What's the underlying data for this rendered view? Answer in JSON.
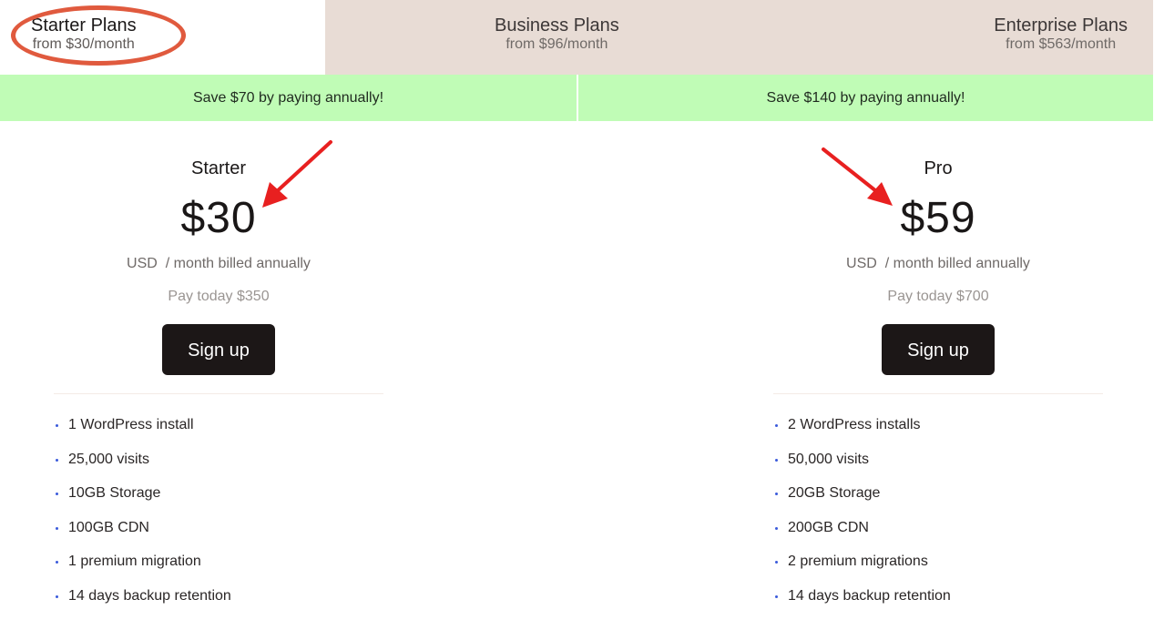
{
  "tabs": [
    {
      "title": "Starter Plans",
      "subtitle": "from $30/month",
      "active": true
    },
    {
      "title": "Business Plans",
      "subtitle": "from $96/month",
      "active": false
    },
    {
      "title": "Enterprise Plans",
      "subtitle": "from $563/month",
      "active": false
    }
  ],
  "savings": [
    "Save $70 by paying annually!",
    "Save $140 by paying annually!"
  ],
  "plans": [
    {
      "name": "Starter",
      "price": "$30",
      "period": "USD  / month billed annually",
      "pay_today": "Pay today $350",
      "cta": "Sign up",
      "features": [
        "1 WordPress install",
        "25,000 visits",
        "10GB Storage",
        "100GB CDN",
        "1 premium migration",
        "14 days backup retention"
      ]
    },
    {
      "name": "Pro",
      "price": "$59",
      "period": "USD  / month billed annually",
      "pay_today": "Pay today $700",
      "cta": "Sign up",
      "features": [
        "2 WordPress installs",
        "50,000 visits",
        "20GB Storage",
        "200GB CDN",
        "2 premium migrations",
        "14 days backup retention"
      ]
    }
  ],
  "colors": {
    "savings_bg": "#c0fcb6",
    "inactive_tab_bg": "#e8dcd5",
    "button_bg": "#1c1717",
    "annotation_red": "#e82020",
    "annotation_circle": "#e05a3e",
    "bullet": "#3b5bdb"
  }
}
